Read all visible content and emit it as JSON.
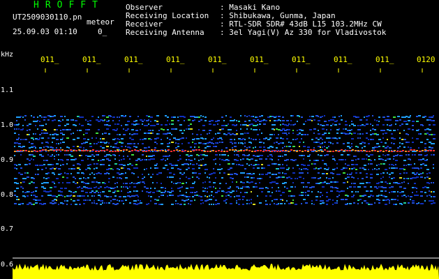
{
  "header": {
    "logo": "HROFFT",
    "filename": "UT2509030110.pn",
    "mode": "meteor",
    "datetime": "25.09.03 01:10",
    "datetime_value": "0_",
    "fields": [
      {
        "label": "Observer",
        "value": ": Masaki Kano"
      },
      {
        "label": "Receiving Location",
        "value": ": Shibukawa, Gunma, Japan"
      },
      {
        "label": "Receiver",
        "value": ": RTL-SDR SDR# 43dB L15 103.2MHz CW"
      },
      {
        "label": "Receiving Antenna",
        "value": ": 3el Yagi(V) Az 330 for Vladivostok"
      }
    ]
  },
  "axes": {
    "freq_unit": "kHz",
    "freq_ticks": [
      "1.1",
      "1.0",
      "0.9",
      "0.8",
      "0.7",
      "0.6"
    ],
    "time_ticks": [
      "011_",
      "011_",
      "011_",
      "011_",
      "011_",
      "011_",
      "011_",
      "011_",
      "011_",
      "0120"
    ]
  },
  "colors": {
    "background": "#000000",
    "label_white": "#ffffff",
    "label_yellow": "#ffff00",
    "logo_green": "#00ff00",
    "signal_noise": "#1f3fd0",
    "signal_strong": "#ff3030",
    "level_bar": "#ffff00"
  }
}
